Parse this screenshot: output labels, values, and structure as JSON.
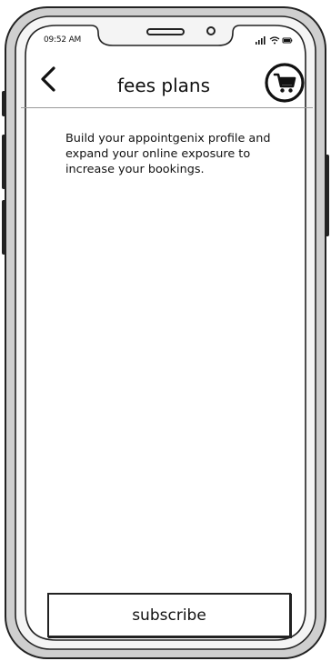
{
  "status_bar": {
    "time": "09:52 AM",
    "icons": [
      "signal-icon",
      "wifi-icon",
      "battery-icon"
    ]
  },
  "header": {
    "back_icon": "chevron-left-icon",
    "title": "fees plans",
    "cart_icon": "cart-icon"
  },
  "content": {
    "description": "Build your appointgenix profile and expand your online exposure to increase your bookings."
  },
  "footer": {
    "subscribe_label": "subscribe"
  }
}
